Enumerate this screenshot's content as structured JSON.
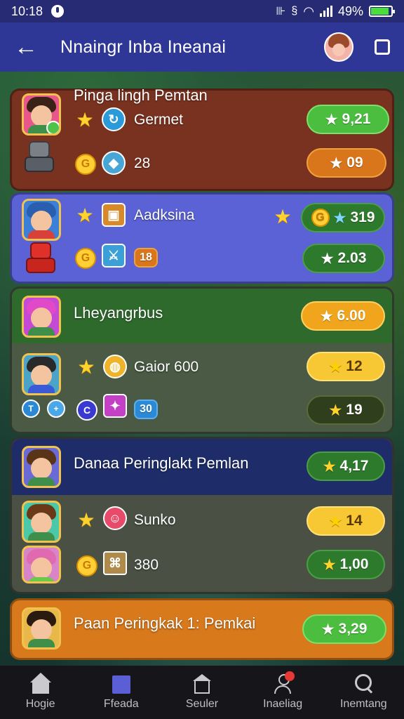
{
  "status_bar": {
    "time": "10:18",
    "battery_text": "49%",
    "battery_level": 0.9
  },
  "app_bar": {
    "back_glyph": "←",
    "title": "Nnaingr Inba Ineanai"
  },
  "cards": [
    {
      "color": "#7a3220",
      "heading": "Pinga lingh Pemtan",
      "row1": {
        "label": "Germet",
        "pill": "9,21",
        "pill_style": "green"
      },
      "row2": {
        "label": "28",
        "pill": "09",
        "pill_style": "orange"
      }
    },
    {
      "color": "#5a62d6",
      "heading": "",
      "row1": {
        "label": "Aadksina",
        "pill": "319",
        "pill_style": "dgreen"
      },
      "row2": {
        "label": "18",
        "pill": "2.03",
        "pill_style": "dgreen"
      }
    },
    {
      "color": "#2e6a2c",
      "heading": "Lheyangrbus",
      "row1": {
        "label": "",
        "pill": "6.00",
        "pill_style": "amber"
      },
      "row2": {
        "label": "Gaior 600",
        "pill": "12",
        "pill_style": "yellow"
      },
      "row3": {
        "label": "30",
        "pill": "19",
        "pill_style": "dark"
      }
    },
    {
      "color": "#1e2d6a",
      "heading": "Danaa Peringlakt Pemlan",
      "row1": {
        "label": "",
        "pill": "4,17",
        "pill_style": "dgreen"
      },
      "row2": {
        "label": "Sunko",
        "pill": "14",
        "pill_style": "yellow"
      },
      "row3": {
        "label": "380",
        "pill": "1,00",
        "pill_style": "dgreen"
      }
    },
    {
      "color": "#d8791c",
      "heading": "Paan Peringkak 1: Pemkai",
      "row1": {
        "label": "",
        "pill": "3,29",
        "pill_style": "green"
      }
    }
  ],
  "bottom_nav": [
    {
      "label": "Hogie",
      "icon": "home-icon"
    },
    {
      "label": "Ffeada",
      "icon": "feed-icon"
    },
    {
      "label": "Seuler",
      "icon": "shop-icon"
    },
    {
      "label": "Inaeliag",
      "icon": "person-icon"
    },
    {
      "label": "Inemtang",
      "icon": "search-icon"
    }
  ],
  "colors": {
    "status_bar": "#272b74",
    "app_bar": "#2f3796",
    "nav_bg": "#16161a"
  }
}
